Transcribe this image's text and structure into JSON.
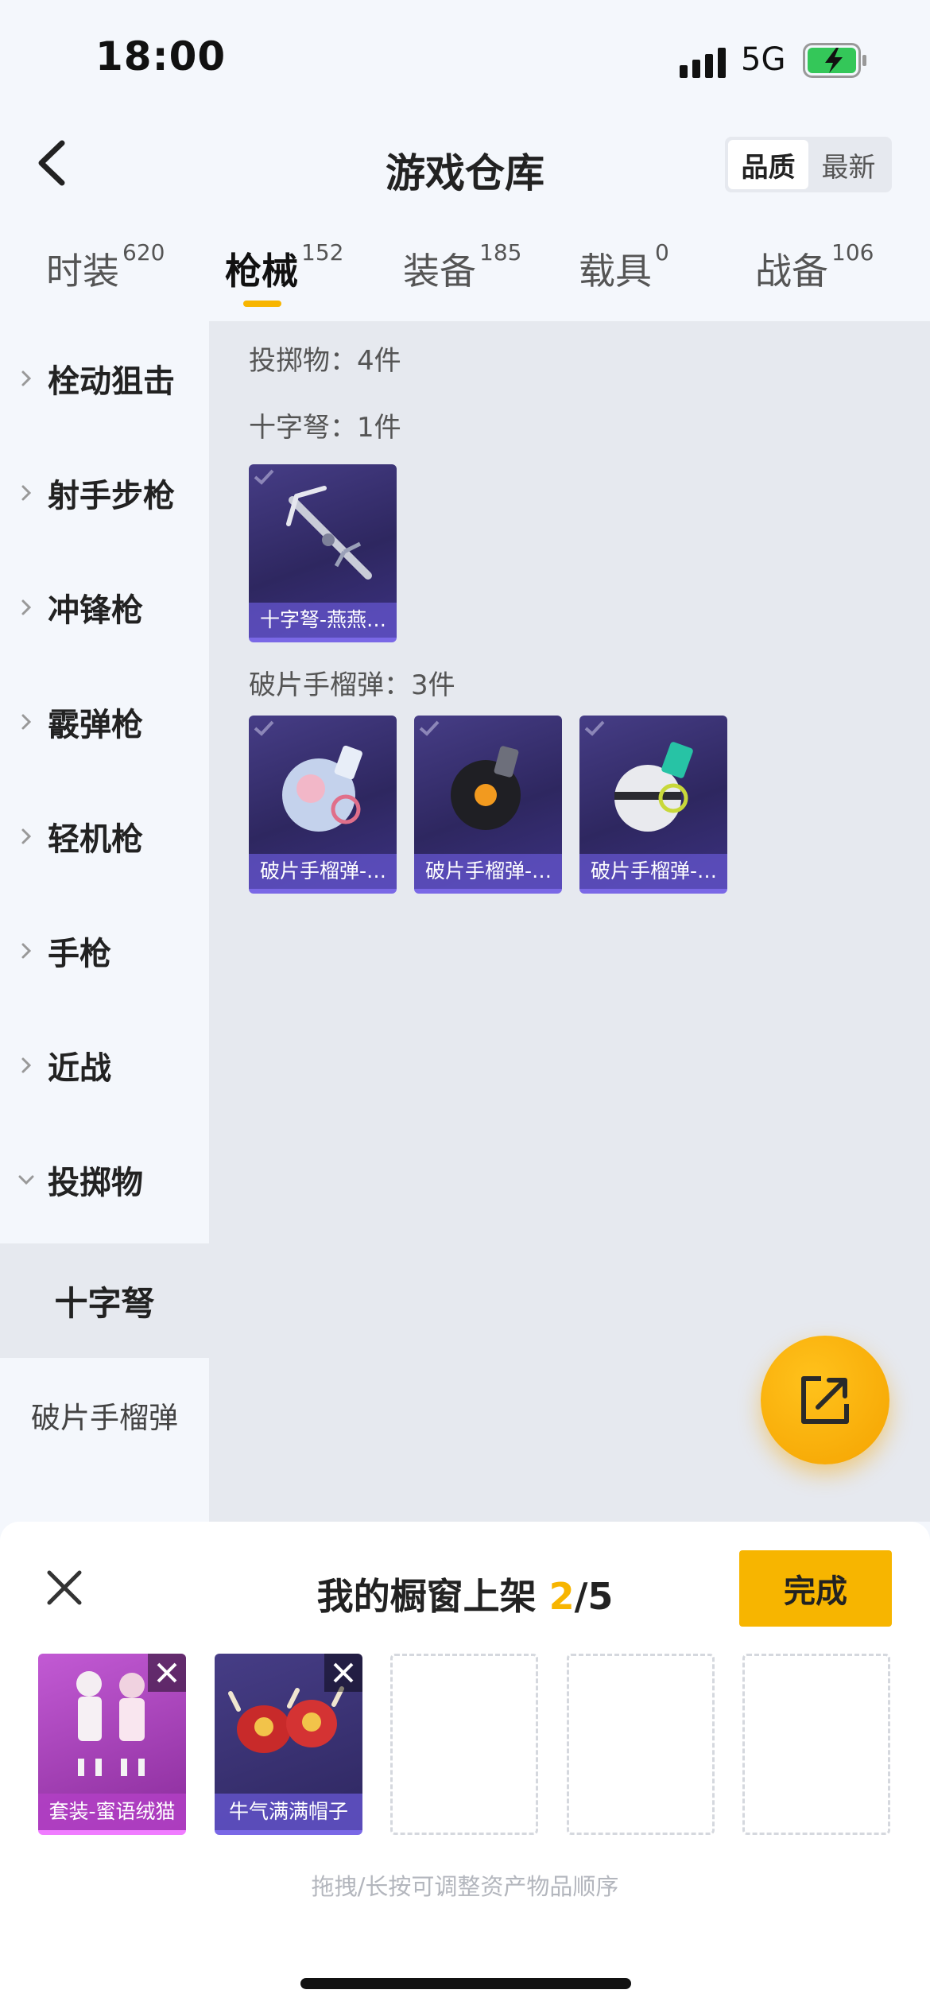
{
  "status_bar": {
    "time": "18:00",
    "network": "5G"
  },
  "header": {
    "title": "游戏仓库",
    "sort_options": [
      "品质",
      "最新"
    ],
    "sort_selected": "品质"
  },
  "tabs": [
    {
      "label": "时装",
      "count": "620"
    },
    {
      "label": "枪械",
      "count": "152",
      "active": true
    },
    {
      "label": "装备",
      "count": "185"
    },
    {
      "label": "载具",
      "count": "0"
    },
    {
      "label": "战备",
      "count": "106"
    }
  ],
  "sidebar": {
    "categories": [
      "栓动狙击",
      "射手步枪",
      "冲锋枪",
      "霰弹枪",
      "轻机枪",
      "手枪",
      "近战",
      "投掷物"
    ],
    "subcategories": [
      "十字弩",
      "破片手榴弹"
    ],
    "active_subcategory": "十字弩"
  },
  "content": {
    "group_label": "投掷物：4件",
    "sections": [
      {
        "label": "十字弩：1件",
        "items": [
          {
            "name": "十字弩-燕燕…"
          }
        ]
      },
      {
        "label": "破片手榴弹：3件",
        "items": [
          {
            "name": "破片手榴弹-…"
          },
          {
            "name": "破片手榴弹-…"
          },
          {
            "name": "破片手榴弹-…"
          }
        ]
      }
    ]
  },
  "showcase": {
    "title": "我的橱窗上架",
    "count": "2",
    "total": "/5",
    "done_label": "完成",
    "slots": [
      {
        "name": "套装-蜜语绒猫",
        "color": "#b23fc4"
      },
      {
        "name": "牛气满满帽子",
        "color": "#3c3483"
      }
    ],
    "empty_slots": 3,
    "hint": "拖拽/长按可调整资产物品顺序"
  },
  "colors": {
    "accent": "#f7b500",
    "card_purple": "#2e2760",
    "highlight": "#7a68e6"
  }
}
